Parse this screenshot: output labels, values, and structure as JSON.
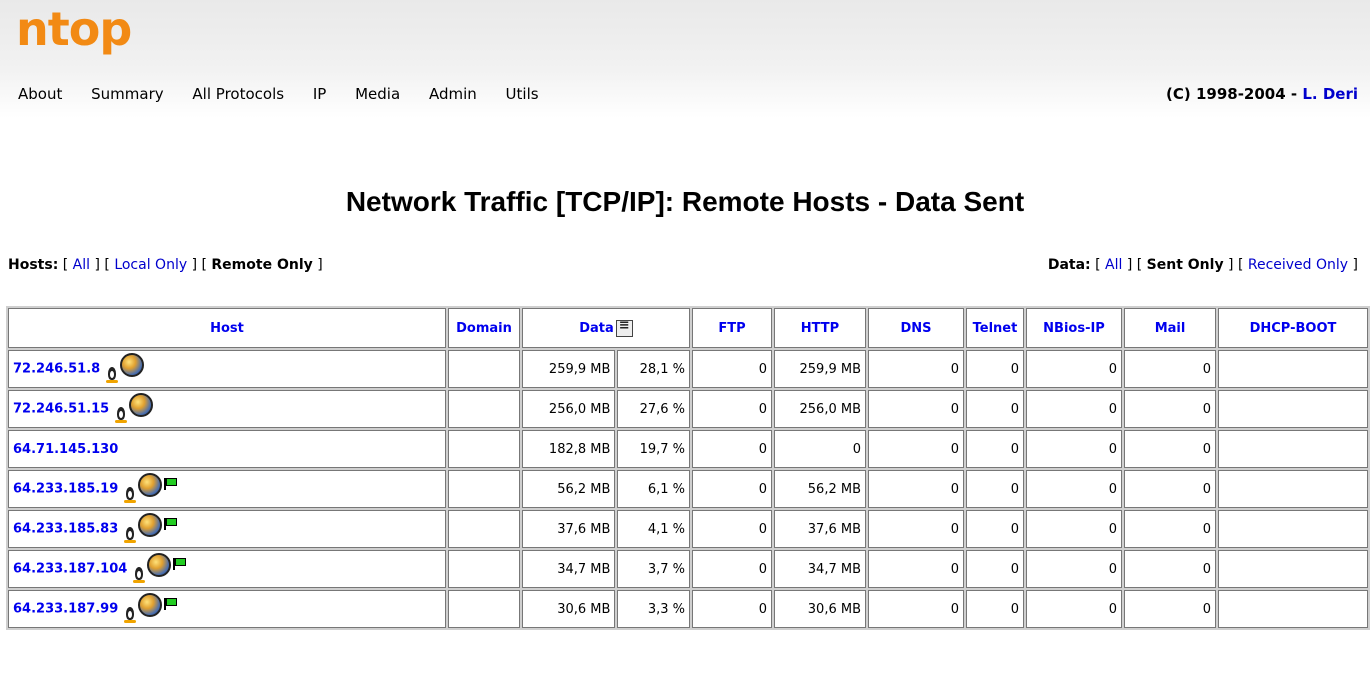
{
  "logo": "ntop",
  "menu": [
    "About",
    "Summary",
    "All Protocols",
    "IP",
    "Media",
    "Admin",
    "Utils"
  ],
  "copyright": {
    "prefix": "(C) 1998-2004 - ",
    "author": "L. Deri"
  },
  "page_title": "Network Traffic [TCP/IP]: Remote Hosts - Data Sent",
  "hosts_filter": {
    "label": "Hosts:",
    "all": "All",
    "local": "Local Only",
    "remote": "Remote Only"
  },
  "data_filter": {
    "label": "Data:",
    "all": "All",
    "sent": "Sent Only",
    "received": "Received Only"
  },
  "table": {
    "headers": {
      "host": "Host",
      "domain": "Domain",
      "data": "Data",
      "ftp": "FTP",
      "http": "HTTP",
      "dns": "DNS",
      "telnet": "Telnet",
      "nbios": "NBios-IP",
      "mail": "Mail",
      "dhcp": "DHCP-BOOT"
    },
    "rows": [
      {
        "host": "72.246.51.8",
        "icons": [
          "penguin-icon",
          "globe-icon"
        ],
        "data": "259,9 MB",
        "pct": "28,1 %",
        "ftp": "0",
        "http": "259,9 MB",
        "dns": "0",
        "telnet": "0",
        "nbios": "0",
        "mail": "0"
      },
      {
        "host": "72.246.51.15",
        "icons": [
          "penguin-icon",
          "globe-icon"
        ],
        "data": "256,0 MB",
        "pct": "27,6 %",
        "ftp": "0",
        "http": "256,0 MB",
        "dns": "0",
        "telnet": "0",
        "nbios": "0",
        "mail": "0"
      },
      {
        "host": "64.71.145.130",
        "icons": [],
        "data": "182,8 MB",
        "pct": "19,7 %",
        "ftp": "0",
        "http": "0",
        "dns": "0",
        "telnet": "0",
        "nbios": "0",
        "mail": "0"
      },
      {
        "host": "64.233.185.19",
        "icons": [
          "penguin-icon",
          "globe-icon",
          "flag-icon"
        ],
        "data": "56,2 MB",
        "pct": "6,1 %",
        "ftp": "0",
        "http": "56,2 MB",
        "dns": "0",
        "telnet": "0",
        "nbios": "0",
        "mail": "0"
      },
      {
        "host": "64.233.185.83",
        "icons": [
          "penguin-icon",
          "globe-icon",
          "flag-icon"
        ],
        "data": "37,6 MB",
        "pct": "4,1 %",
        "ftp": "0",
        "http": "37,6 MB",
        "dns": "0",
        "telnet": "0",
        "nbios": "0",
        "mail": "0"
      },
      {
        "host": "64.233.187.104",
        "icons": [
          "penguin-icon",
          "globe-icon",
          "flag-icon"
        ],
        "data": "34,7 MB",
        "pct": "3,7 %",
        "ftp": "0",
        "http": "34,7 MB",
        "dns": "0",
        "telnet": "0",
        "nbios": "0",
        "mail": "0"
      },
      {
        "host": "64.233.187.99",
        "icons": [
          "penguin-icon",
          "globe-icon",
          "flag-icon"
        ],
        "data": "30,6 MB",
        "pct": "3,3 %",
        "ftp": "0",
        "http": "30,6 MB",
        "dns": "0",
        "telnet": "0",
        "nbios": "0",
        "mail": "0"
      }
    ]
  },
  "colors": {
    "logo": "#f28a14",
    "link": "#0000ee",
    "flag": "#22cc22"
  }
}
